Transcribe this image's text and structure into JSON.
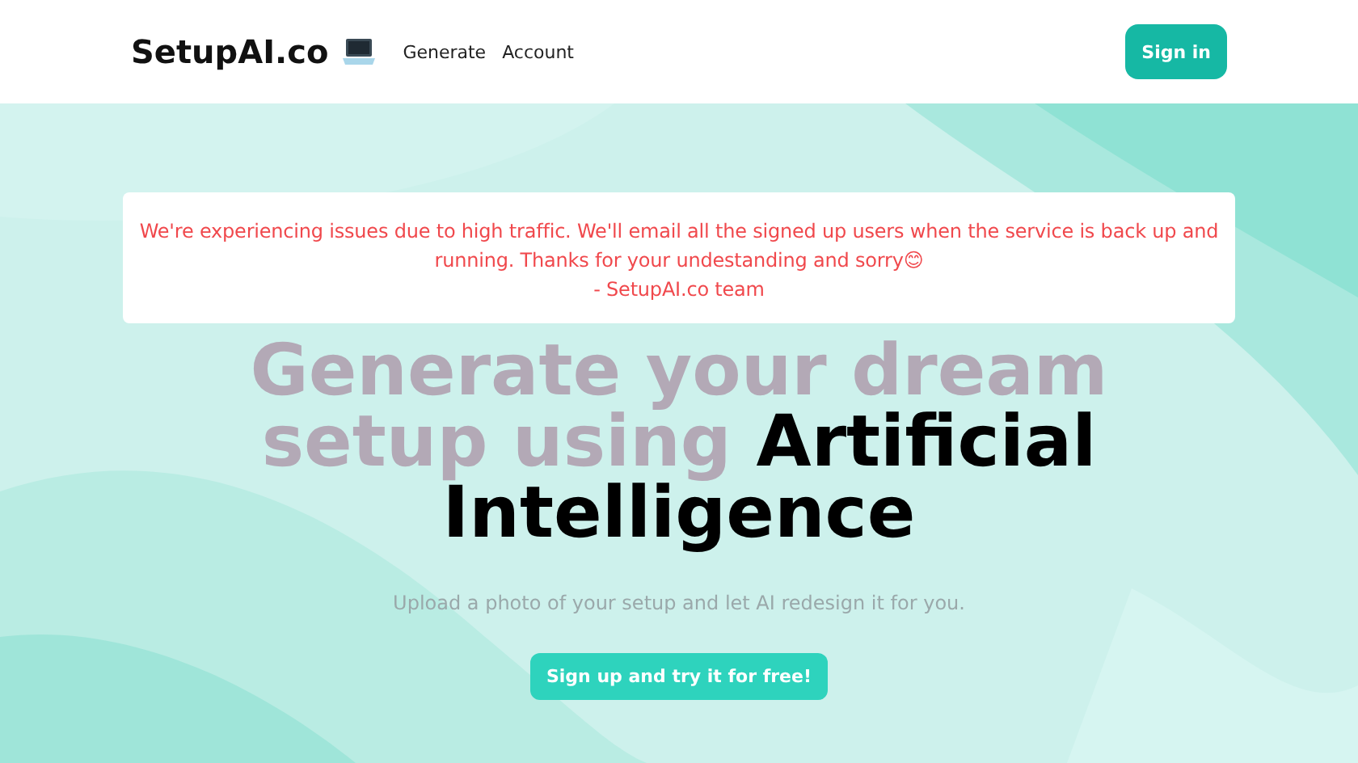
{
  "header": {
    "logo": "SetupAI.co",
    "nav": [
      "Generate",
      "Account"
    ],
    "sign_in": "Sign in"
  },
  "notice": {
    "lines": [
      "We're experiencing issues due to high traffic. We'll email all the signed up users when the service is back up and running. Thanks for your undestanding and sorry😊",
      "- SetupAI.co team"
    ]
  },
  "headline": {
    "faded": "Generate your dream setup using",
    "strong": "Artificial Intelligence"
  },
  "subtitle": "Upload a photo of your setup and let AI redesign it for you.",
  "cta": "Sign up and try it for free!"
}
